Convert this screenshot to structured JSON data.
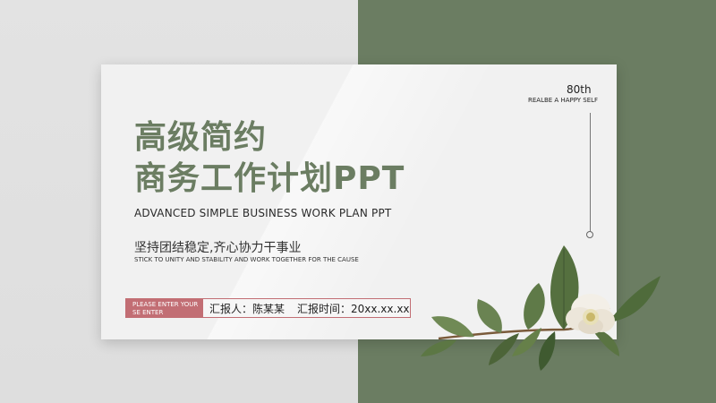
{
  "badge": {
    "number": "80th",
    "tagline": "REALBE A HAPPY SELF"
  },
  "title": {
    "line1": "高级简约",
    "line2": "商务工作计划PPT"
  },
  "subtitle_en": "ADVANCED SIMPLE BUSINESS WORK PLAN PPT",
  "slogan": {
    "cn": "坚持团结稳定,齐心协力干事业",
    "en": "STICK TO UNITY AND STABILITY AND WORK TOGETHER FOR THE CAUSE"
  },
  "presenter": {
    "prompt_line1": "PLEASE ENTER YOUR",
    "prompt_line2": "SE ENTER",
    "reporter": "汇报人：陈某某",
    "time": "汇报时间：20xx.xx.xx"
  },
  "colors": {
    "accent_green": "#6b7d62",
    "accent_pink": "#c26e74"
  }
}
